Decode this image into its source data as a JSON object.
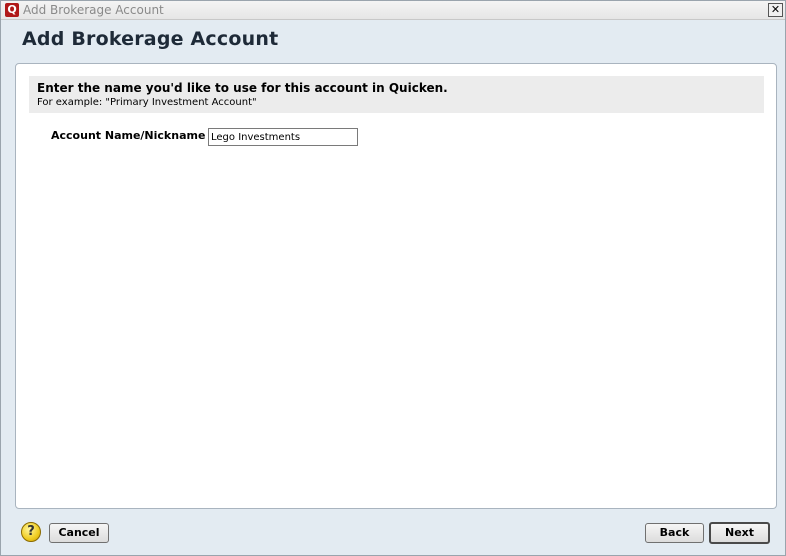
{
  "window": {
    "title": "Add Brokerage Account",
    "app_icon_letter": "Q",
    "close_glyph": "✕"
  },
  "header": {
    "title": "Add Brokerage Account"
  },
  "instruction": {
    "main": "Enter the name you'd like to use for this account in Quicken.",
    "example": "For example: \"Primary Investment Account\""
  },
  "form": {
    "account_name_label": "Account Name/Nickname",
    "account_name_value": "Lego Investments"
  },
  "footer": {
    "help_glyph": "?",
    "cancel_label": "Cancel",
    "back_label": "Back",
    "next_label": "Next"
  },
  "icons": {
    "app": "quicken-app-icon",
    "close": "close-icon",
    "help": "help-icon"
  }
}
